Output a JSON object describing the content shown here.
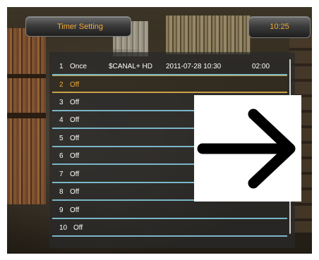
{
  "header": {
    "title": "Timer Setting",
    "clock": "10:25"
  },
  "timer_list": [
    {
      "number": "1",
      "mode": "Once",
      "channel": "$CANAL+ HD",
      "date_time": "2011-07-28 10:30",
      "duration": "02:00"
    },
    {
      "number": "2",
      "mode": "Off"
    },
    {
      "number": "3",
      "mode": "Off"
    },
    {
      "number": "4",
      "mode": "Off"
    },
    {
      "number": "5",
      "mode": "Off"
    },
    {
      "number": "6",
      "mode": "Off"
    },
    {
      "number": "7",
      "mode": "Off"
    },
    {
      "number": "8",
      "mode": "Off"
    },
    {
      "number": "9",
      "mode": "Off"
    },
    {
      "number": "10",
      "mode": "Off"
    }
  ],
  "selected_index": 1,
  "overlay": {
    "icon": "right-arrow-icon"
  },
  "colors": {
    "accent": "#f2a93a",
    "row_divider": "#7ab6c8",
    "selected_border": "#c9a24a",
    "text": "#ffffff"
  }
}
